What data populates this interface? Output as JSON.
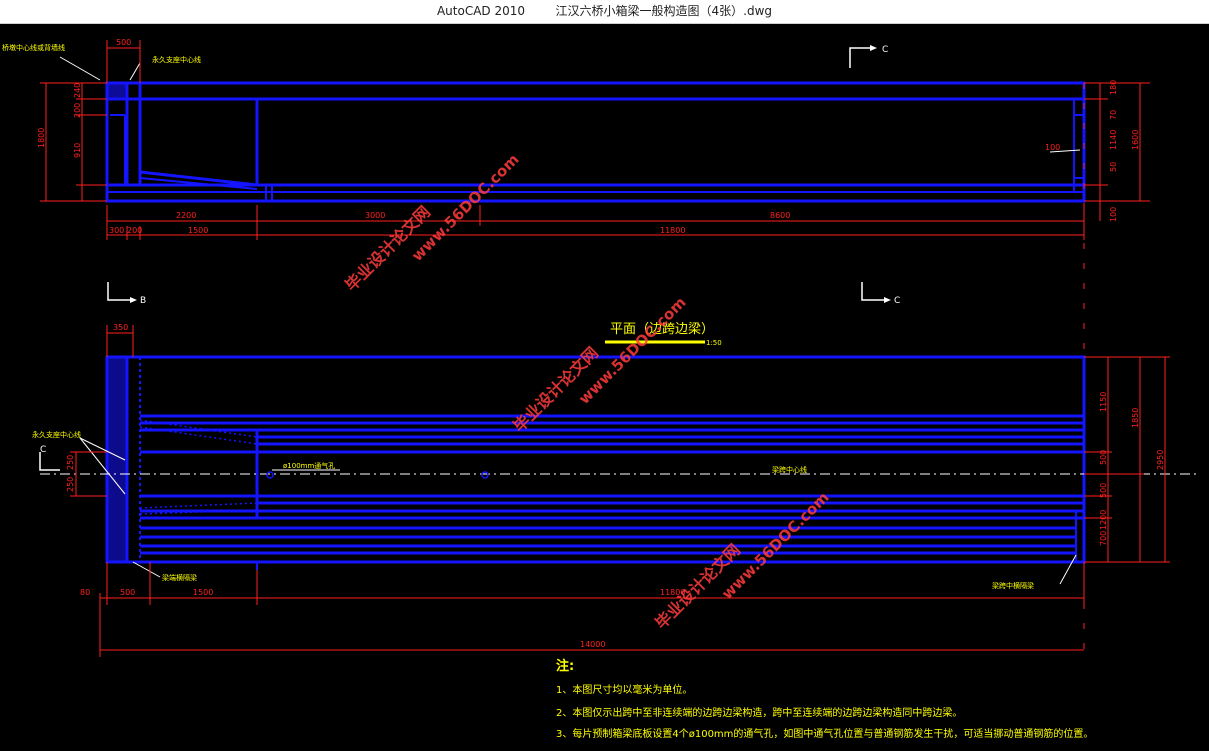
{
  "window": {
    "app_name": "AutoCAD 2010",
    "file_name": "江汉六桥小箱梁一般构造图（4张）.dwg"
  },
  "drawing": {
    "elevation": {
      "top_left_dim": "500",
      "label_left": "桥墩中心线或背墙线",
      "label_center": "永久支座中心线",
      "section_mark": "C",
      "height_dims": [
        "1800",
        "910",
        "200",
        "240",
        "50"
      ],
      "right_dims": [
        "180",
        "70",
        "1140",
        "50",
        "100",
        "1600"
      ],
      "tag_100": "100",
      "bottom_row1": [
        "2200",
        "3000",
        "8600"
      ],
      "bottom_row2": [
        "300",
        "200",
        "1500",
        "11800"
      ]
    },
    "plan": {
      "title": "平面（边跨边梁）",
      "scale": "1:50",
      "section_mark_b": "B",
      "section_mark_c": "C",
      "section_mark_left": "C",
      "top_dim": "350",
      "label_support": "永久支座中心线",
      "label_vent": "ø100mm通气孔",
      "label_center": "梁跨中心线",
      "label_endbeam": "梁端横隔梁",
      "label_midbeam": "梁跨中横隔梁",
      "left_small_dims": [
        "250",
        "250"
      ],
      "right_dims": [
        "1150",
        "500",
        "500",
        "1200",
        "700"
      ],
      "right_dims_outer": [
        "1850",
        "2950"
      ],
      "bottom_dims": [
        "80",
        "500",
        "1500",
        "11800"
      ],
      "total_dim": "14000"
    },
    "notes": {
      "heading": "注:",
      "items": [
        "1、本图尺寸均以毫米为单位。",
        "2、本图仅示出跨中至非连续端的边跨边梁构造，跨中至连续端的边跨边梁构造同中跨边梁。",
        "3、每片预制箱梁底板设置4个ø100mm的通气孔，如图中通气孔位置与普通钢筋发生干扰，可适当挪动普通钢筋的位置。"
      ]
    },
    "watermark": {
      "line1": "毕业设计论文网",
      "line2": "www.56DOC.com"
    },
    "colors": {
      "background": "#000000",
      "structure": "#1414ff",
      "dimension": "#ff2020",
      "text": "#ffff00",
      "leader": "#ffffff",
      "watermark": "#ff3c3c"
    }
  }
}
